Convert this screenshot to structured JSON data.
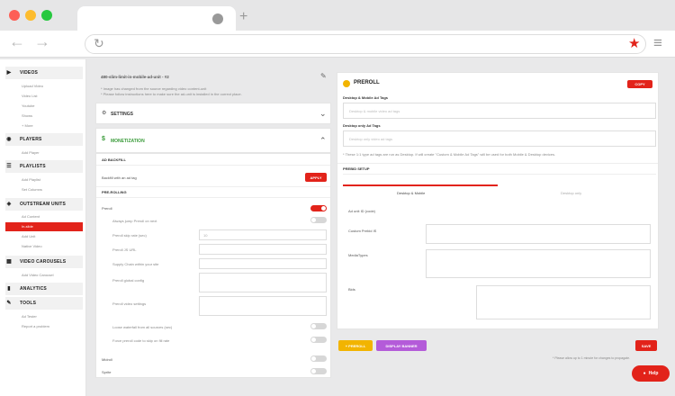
{
  "browser": {
    "new_tab_label": "+",
    "back_icon": "←",
    "forward_icon": "→",
    "reload_icon": "↻",
    "star_icon": "★",
    "menu_icon": "≡"
  },
  "sidebar": {
    "sections": [
      {
        "title": "VIDEOS",
        "icon": "▶",
        "items": [
          "Upload Video",
          "Video List",
          "Youtube",
          "Shows",
          "+ More"
        ]
      },
      {
        "title": "PLAYERS",
        "icon": "◉",
        "items": [
          "Add Player"
        ]
      },
      {
        "title": "PLAYLISTS",
        "icon": "☰",
        "items": [
          "Add Playlist",
          "Set Columns"
        ]
      },
      {
        "title": "OUTSTREAM UNITS",
        "icon": "◈",
        "items": [
          "Ad Content",
          "In-slide",
          "Add Unit",
          "Native Video"
        ]
      },
      {
        "title": "VIDEO CAROUSELS",
        "icon": "▦",
        "items": [
          "Add Video Carousel"
        ]
      },
      {
        "title": "ANALYTICS",
        "icon": "▮",
        "items": []
      },
      {
        "title": "TOOLS",
        "icon": "✎",
        "items": [
          "Ad Tester",
          "Report a problem"
        ]
      }
    ],
    "active_item": "In-slide"
  },
  "left": {
    "unit_title": "480-slim-limit-in-mobile-ad-unit - #2",
    "notes": [
      "* Image has changed from the source regarding video content-unit",
      "* Please follow instructions here to make sure the ad-unit is installed in the correct place."
    ],
    "settings_label": "SETTINGS",
    "monetization_label": "MONETIZATION",
    "ad_backfill_label": "AD BACKFILL",
    "backfill_row_label": "Backfill with an ad tag",
    "apply_label": "APPLY",
    "preroll_label": "PRE-ROLLING",
    "rows": [
      {
        "label": "Preroll",
        "kind": "toggle",
        "on": true
      },
      {
        "label": "Always jump Preroll on next",
        "kind": "toggle",
        "on": false
      },
      {
        "label": "Preroll skip rate (sec)",
        "kind": "input"
      },
      {
        "label": "Preroll JS URL",
        "kind": "input"
      },
      {
        "label": "Supply Chain within your site",
        "kind": "input"
      },
      {
        "label": "Preroll global config",
        "kind": "textarea"
      },
      {
        "label": "Preroll video settings",
        "kind": "textarea"
      },
      {
        "label": "Loose waterfall from all sources (sec)",
        "kind": "toggle",
        "on": false
      },
      {
        "label": "Force preroll code to skip on fill rate",
        "kind": "toggle",
        "on": false
      },
      {
        "label": "Midroll",
        "kind": "toggle",
        "on": false
      },
      {
        "label": "Sprite",
        "kind": "toggle",
        "on": false
      }
    ],
    "skip_rate_value": "10"
  },
  "right": {
    "title": "PREROLL",
    "copy_label": "COPY",
    "desktop_mobile_label": "Desktop & Mobile Ad Tags",
    "desktop_mobile_placeholder": "Desktop & mobile video ad tags",
    "desktop_only_label": "Desktop only Ad Tags",
    "desktop_only_placeholder": "Desktop only video ad tags",
    "note": "* These 1:1 type ad tags are run as Desktop. If will create \"Custom & Mobile Ad Tags\" will be used for both Mobile & Desktop devices.",
    "setup_label": "PREBID SETUP",
    "tabs": [
      "Desktop & Mobile",
      "Desktop only"
    ],
    "fields": [
      {
        "label": "Ad unit ID (code)",
        "kind": "text"
      },
      {
        "label": "Custom Prebid IS",
        "kind": "textarea"
      },
      {
        "label": "MediaTypes",
        "kind": "textarea"
      },
      {
        "label": "Bids",
        "kind": "textarea"
      }
    ],
    "add_preroll_label": "+ PREROLL",
    "display_banner_label": "DISPLAY BANNER",
    "save_label": "SAVE",
    "footer_note": "* Please allow up to 1 minute for changes to propagate.",
    "help_label": "Help"
  },
  "colors": {
    "accent": "#e2231a",
    "green": "#3a9b3a",
    "yellow": "#f2b400",
    "purple": "#b45bd9"
  }
}
